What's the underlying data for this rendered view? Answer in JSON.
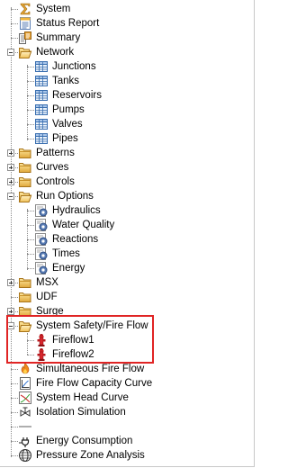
{
  "tree": {
    "root_items": [
      {
        "key": "system",
        "label": "System",
        "icon": "sigma-icon"
      },
      {
        "key": "status",
        "label": "Status Report",
        "icon": "report-icon"
      },
      {
        "key": "summary",
        "label": "Summary",
        "icon": "summary-icon"
      }
    ],
    "network": {
      "label": "Network",
      "children": [
        "Junctions",
        "Tanks",
        "Reservoirs",
        "Pumps",
        "Valves",
        "Pipes"
      ]
    },
    "folders_a": [
      "Patterns",
      "Curves",
      "Controls"
    ],
    "run_options": {
      "label": "Run Options",
      "children": [
        "Hydraulics",
        "Water Quality",
        "Reactions",
        "Times",
        "Energy"
      ]
    },
    "folders_b": [
      "MSX",
      "UDF",
      "Surge"
    ],
    "system_safety": {
      "label": "System Safety/Fire Flow",
      "children": [
        "Fireflow1",
        "Fireflow2"
      ]
    },
    "tail_items": [
      {
        "key": "simfire",
        "label": "Simultaneous Fire Flow",
        "icon": "fire-icon"
      },
      {
        "key": "ffcap",
        "label": "Fire Flow Capacity Curve",
        "icon": "capacity-doc-icon"
      },
      {
        "key": "syshead",
        "label": "System Head Curve",
        "icon": "head-curve-icon"
      },
      {
        "key": "isolation",
        "label": "Isolation Simulation",
        "icon": "valve-icon"
      },
      {
        "key": "sep",
        "label": "",
        "icon": "separator-icon"
      },
      {
        "key": "energy",
        "label": "Energy Consumption",
        "icon": "plug-icon"
      },
      {
        "key": "pressure",
        "label": "Pressure Zone Analysis",
        "icon": "globe-icon"
      }
    ]
  },
  "colors": {
    "highlight_border": "#e02424",
    "folder": "#e8b84a",
    "grid": "#3a6fb0"
  }
}
